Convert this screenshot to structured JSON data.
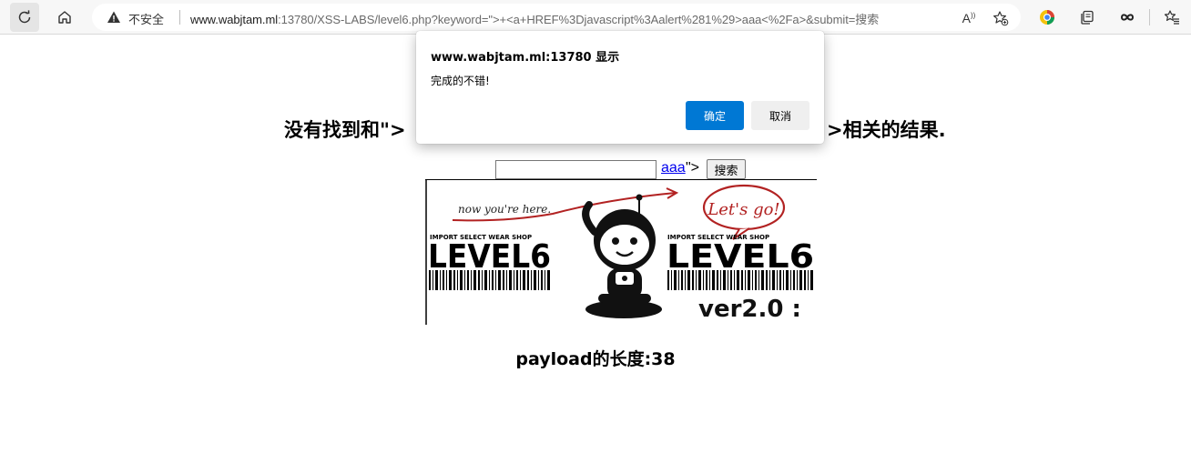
{
  "browser": {
    "security_label": "不安全",
    "url_host": "www.wabjtam.ml",
    "url_rest": ":13780/XSS-LABS/level6.php?keyword=\">+<a+HREF%3Djavascript%3Aalert%281%29>aaa<%2Fa>&submit=搜索",
    "read_aloud_label": "A"
  },
  "page": {
    "heading_left": "没有找到和\">",
    "heading_right": ">相关的结果.",
    "search_value": "",
    "link_text": "aaa",
    "link_tail": "\">",
    "submit_label": "搜索",
    "payload_text": "payload的长度:38"
  },
  "banner": {
    "note": "now you're here.",
    "bubble": "Let's go!",
    "brand_left": "IMPORT SELECT WEAR SHOP",
    "brand_right": "IMPORT SELECT WEAR SHOP",
    "level_left": "LEVEL6",
    "level_right": "LEVEL6",
    "version": "ver2.0 :"
  },
  "dialog": {
    "title": "www.wabjtam.ml:13780 显示",
    "message": "完成的不错!",
    "ok_label": "确定",
    "cancel_label": "取消"
  },
  "colors": {
    "accent": "#0078d4",
    "link": "#0000ee",
    "banner_red": "#b22222"
  }
}
